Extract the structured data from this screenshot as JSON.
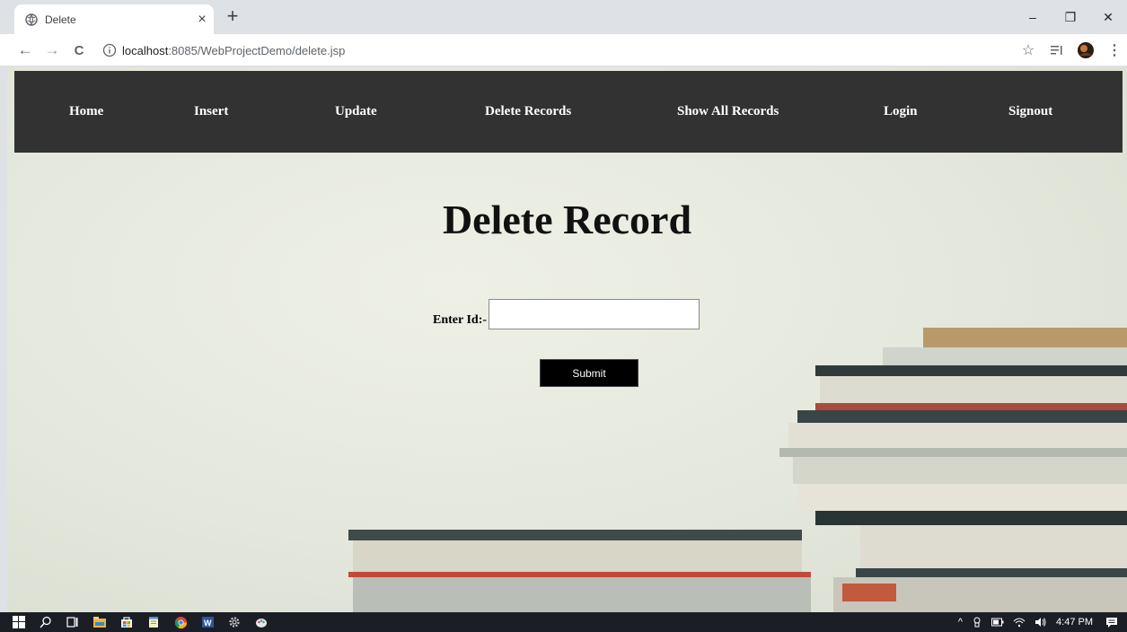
{
  "browser": {
    "tab": {
      "title": "Delete",
      "close_glyph": "×"
    },
    "new_tab_glyph": "+",
    "window_controls": {
      "minimize": "–",
      "restore": "❐",
      "close": "✕"
    },
    "nav": {
      "back": "←",
      "forward": "→",
      "reload": "C"
    },
    "url": {
      "host": "localhost",
      "rest": ":8085/WebProjectDemo/delete.jsp"
    },
    "tools": {
      "bookmark": "☆",
      "menu": "⋮"
    }
  },
  "navbar": {
    "items": [
      {
        "label": "Home"
      },
      {
        "label": "Insert"
      },
      {
        "label": "Update"
      },
      {
        "label": "Delete Records"
      },
      {
        "label": "Show All Records"
      },
      {
        "label": "Login"
      },
      {
        "label": "Signout"
      }
    ]
  },
  "page": {
    "heading": "Delete Record",
    "form": {
      "id_label": "Enter Id:-",
      "id_value": "",
      "submit_label": "Submit"
    }
  },
  "taskbar": {
    "tray": {
      "up_arrow": "^",
      "clock": "4:47 PM"
    }
  }
}
